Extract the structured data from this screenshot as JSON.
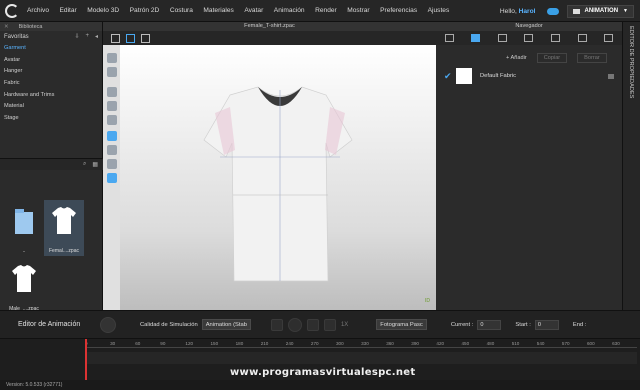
{
  "menubar": {
    "items": [
      "Archivo",
      "Editar",
      "Modelo 3D",
      "Patrón 2D",
      "Costura",
      "Materiales",
      "Avatar",
      "Animación",
      "Render",
      "Mostrar",
      "Preferencias",
      "Ajustes"
    ],
    "hello_prefix": "Hello,",
    "user": "Harol",
    "mode_button": "ANIMATION"
  },
  "library": {
    "title": "Biblioteca",
    "favorites_label": "Favoritas",
    "items": [
      "Garment",
      "Avatar",
      "Hanger",
      "Fabric",
      "Hardware and Trims",
      "Material",
      "Stage"
    ],
    "active_item": "Garment",
    "thumbs": [
      "..",
      "Femal....zpac",
      "Male_....zpac"
    ]
  },
  "viewport": {
    "title": "Female_T-shirt.zpac",
    "corner_label": "ID"
  },
  "navigator": {
    "title": "Navegador",
    "add_label": "+ Añadir",
    "copy_label": "Copiar",
    "delete_label": "Borrar",
    "fabric_name": "Default Fabric"
  },
  "property_editor": {
    "title": "EDITOR DE PROPIEDADES"
  },
  "animation": {
    "title": "Editor de Animación",
    "sim_quality_label": "Calidad de Simulación",
    "sim_quality_value": "Animation (Stab",
    "speed": "1X",
    "frame_mode": "Fotograma Pasc",
    "current_label": "Current :",
    "current_value": "0",
    "start_label": "Start :",
    "start_value": "0",
    "end_label": "End :",
    "ruler_ticks": [
      "0",
      "30",
      "60",
      "90",
      "120",
      "150",
      "180",
      "210",
      "240",
      "270",
      "300",
      "330",
      "360",
      "390",
      "420",
      "450",
      "480",
      "510",
      "540",
      "570",
      "600",
      "630"
    ]
  },
  "status": {
    "version": "Version: 5.0.533 (r32771)"
  },
  "watermark": "www.programasvirtualespc.net",
  "colors": {
    "accent": "#4aa8f0",
    "user": "#5ab4ff",
    "playhead": "#dd3333"
  }
}
